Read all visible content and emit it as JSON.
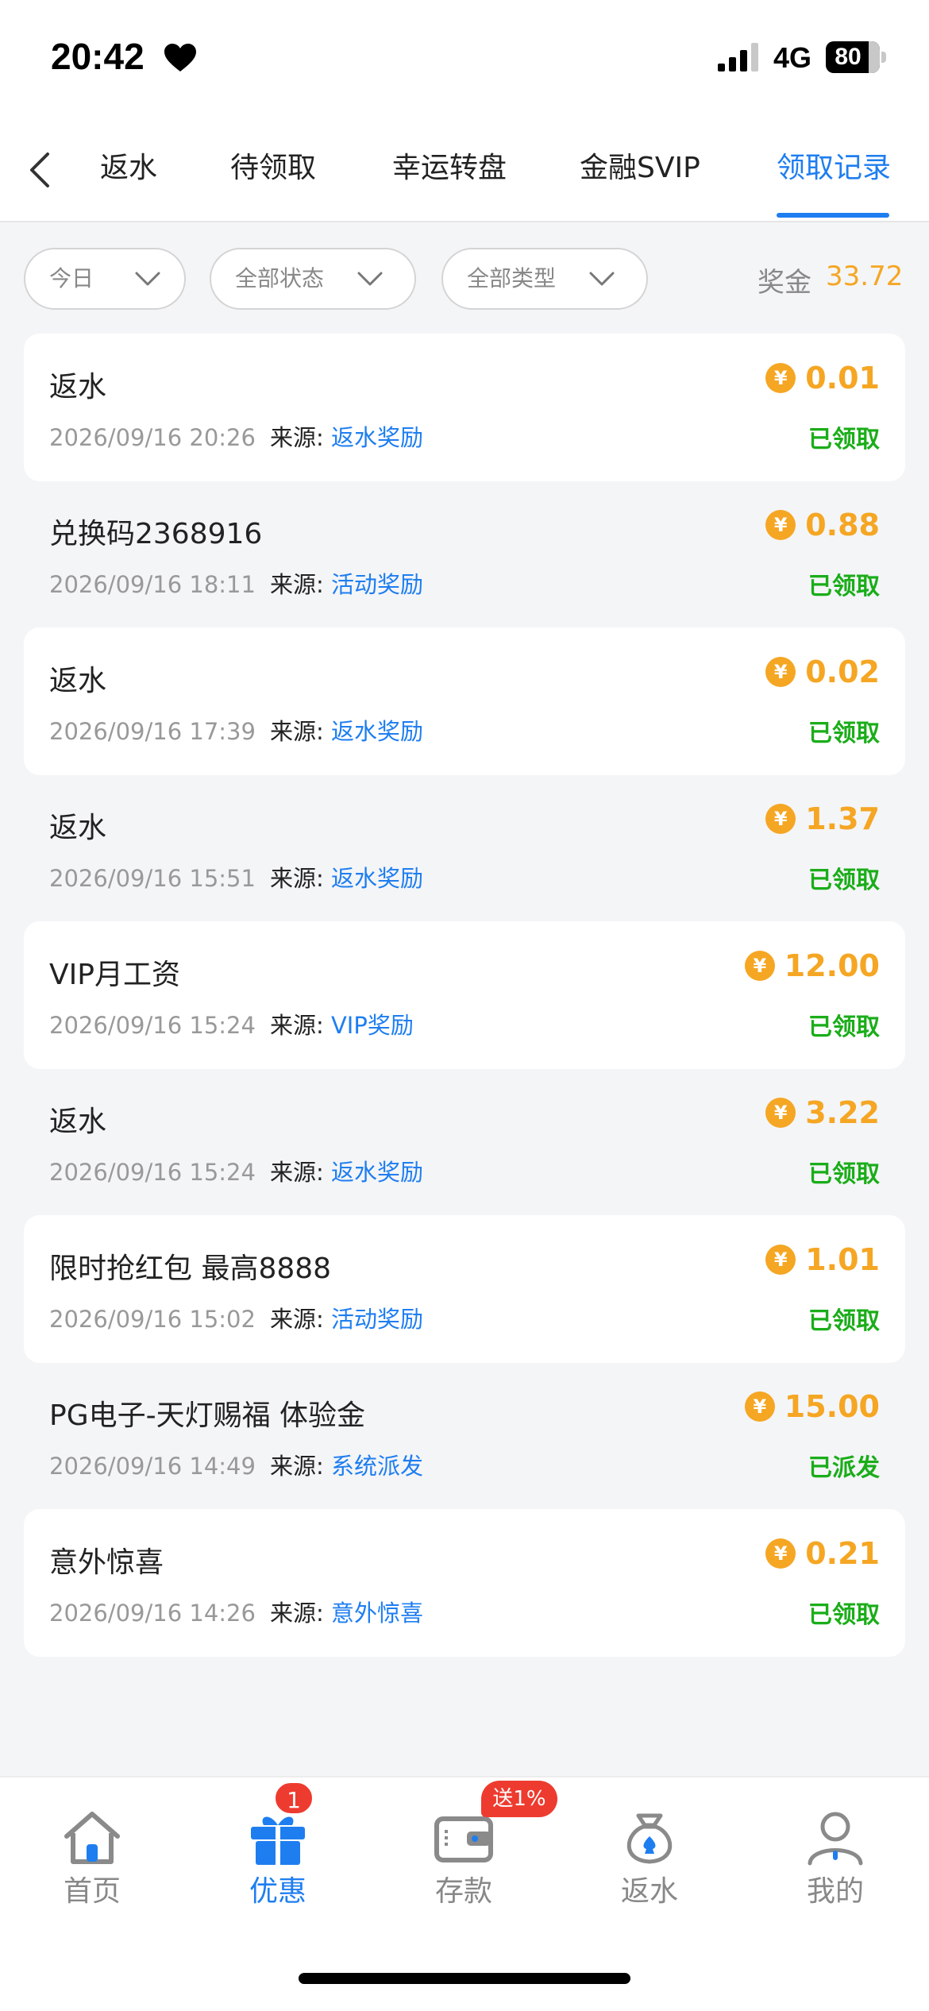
{
  "status_bar": {
    "time": "20:42",
    "network": "4G",
    "battery": "80"
  },
  "tabs": [
    {
      "label": "返水",
      "active": false
    },
    {
      "label": "待领取",
      "active": false
    },
    {
      "label": "幸运转盘",
      "active": false
    },
    {
      "label": "金融SVIP",
      "active": false
    },
    {
      "label": "领取记录",
      "active": true
    }
  ],
  "filters": {
    "date": "今日",
    "status": "全部状态",
    "type": "全部类型"
  },
  "bonus": {
    "label": "奖金",
    "value": "33.72"
  },
  "source_label": "来源:",
  "coin_symbol": "¥",
  "records": [
    {
      "title": "返水",
      "time": "2026/09/16 20:26",
      "source": "返水奖励",
      "amount": "0.01",
      "status": "已领取"
    },
    {
      "title": "兑换码2368916",
      "time": "2026/09/16 18:11",
      "source": "活动奖励",
      "amount": "0.88",
      "status": "已领取"
    },
    {
      "title": "返水",
      "time": "2026/09/16 17:39",
      "source": "返水奖励",
      "amount": "0.02",
      "status": "已领取"
    },
    {
      "title": "返水",
      "time": "2026/09/16 15:51",
      "source": "返水奖励",
      "amount": "1.37",
      "status": "已领取"
    },
    {
      "title": "VIP月工资",
      "time": "2026/09/16 15:24",
      "source": "VIP奖励",
      "amount": "12.00",
      "status": "已领取"
    },
    {
      "title": "返水",
      "time": "2026/09/16 15:24",
      "source": "返水奖励",
      "amount": "3.22",
      "status": "已领取"
    },
    {
      "title": "限时抢红包 最高8888",
      "time": "2026/09/16 15:02",
      "source": "活动奖励",
      "amount": "1.01",
      "status": "已领取"
    },
    {
      "title": "PG电子-天灯赐福 体验金",
      "time": "2026/09/16 14:49",
      "source": "系统派发",
      "amount": "15.00",
      "status": "已派发"
    },
    {
      "title": "意外惊喜",
      "time": "2026/09/16 14:26",
      "source": "意外惊喜",
      "amount": "0.21",
      "status": "已领取"
    }
  ],
  "bottom_nav": {
    "items": [
      {
        "label": "首页",
        "icon": "home-icon"
      },
      {
        "label": "优惠",
        "icon": "gift-icon",
        "active": true
      },
      {
        "label": "存款",
        "icon": "wallet-icon"
      },
      {
        "label": "返水",
        "icon": "money-bag-icon"
      },
      {
        "label": "我的",
        "icon": "user-icon"
      }
    ],
    "promo_badge_count": "1",
    "deposit_badge": "送1%"
  },
  "colors": {
    "accent": "#1e7ef0",
    "amount": "#f5a623",
    "status_green": "#1aad19",
    "badge_red": "#ee3b2f"
  }
}
